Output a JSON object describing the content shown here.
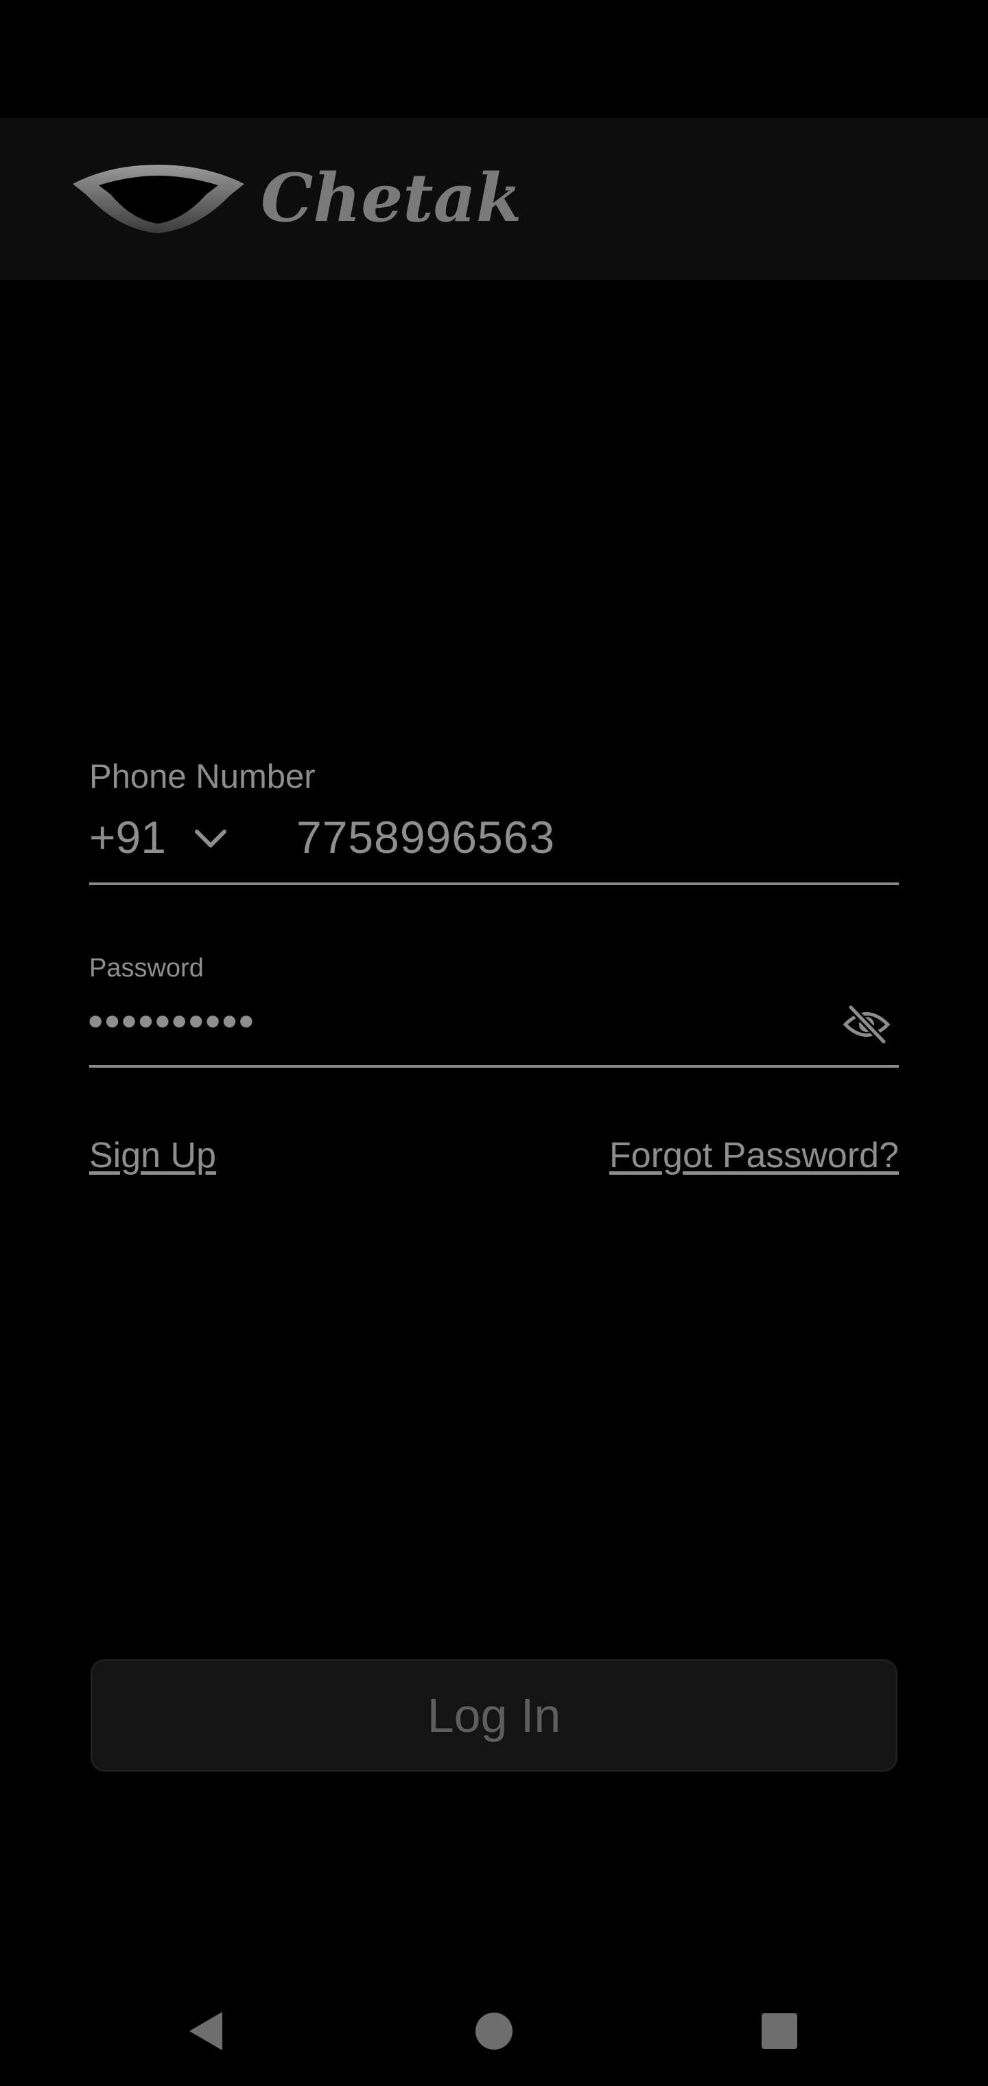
{
  "app": {
    "logo_text": "Chetak"
  },
  "phone": {
    "label": "Phone Number",
    "country_code": "+91",
    "value": "7758996563"
  },
  "password": {
    "label": "Password",
    "masked_value": "••••••••••"
  },
  "links": {
    "sign_up": "Sign Up",
    "forgot_password": "Forgot Password?"
  },
  "actions": {
    "login_label": "Log In"
  },
  "icons": {
    "country_dropdown": "chevron-down-icon",
    "password_toggle": "eye-off-icon",
    "nav_back": "back-triangle-icon",
    "nav_home": "home-circle-icon",
    "nav_recents": "recents-square-icon"
  },
  "colors": {
    "background": "#000000",
    "header_background": "#0d0d0d",
    "text": "#8e8e8e",
    "button_background": "#141414",
    "button_text": "#5e5e5e"
  }
}
